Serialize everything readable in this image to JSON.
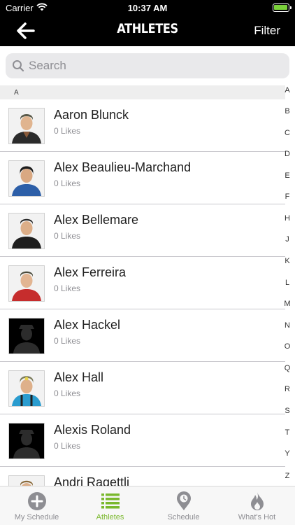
{
  "status_bar": {
    "carrier": "Carrier",
    "time": "10:37 AM"
  },
  "nav": {
    "title": "ATHLETES",
    "filter_label": "Filter"
  },
  "search": {
    "placeholder": "Search"
  },
  "section": {
    "header": "A"
  },
  "athletes": [
    {
      "name": "Aaron Blunck",
      "likes": "0 Likes",
      "avatar": "photo-dark-jacket-icon"
    },
    {
      "name": "Alex Beaulieu-Marchand",
      "likes": "0 Likes",
      "avatar": "photo-blue-jacket-icon"
    },
    {
      "name": "Alex Bellemare",
      "likes": "0 Likes",
      "avatar": "photo-black-jacket-icon"
    },
    {
      "name": "Alex Ferreira",
      "likes": "0 Likes",
      "avatar": "photo-red-jacket-icon"
    },
    {
      "name": "Alex Hackel",
      "likes": "0 Likes",
      "avatar": "silhouette-placeholder-icon"
    },
    {
      "name": "Alex Hall",
      "likes": "0 Likes",
      "avatar": "photo-teal-jacket-icon"
    },
    {
      "name": "Alexis Roland",
      "likes": "0 Likes",
      "avatar": "silhouette-placeholder-icon"
    },
    {
      "name": "Andri Ragettli",
      "likes": "",
      "avatar": "photo-partial-icon"
    }
  ],
  "index_letters": [
    "A",
    "B",
    "C",
    "D",
    "E",
    "F",
    "H",
    "J",
    "K",
    "L",
    "M",
    "N",
    "O",
    "Q",
    "R",
    "S",
    "T",
    "Y",
    "Z"
  ],
  "tabs": [
    {
      "label": "My Schedule",
      "icon": "plus-circle-icon",
      "active": false
    },
    {
      "label": "Athletes",
      "icon": "list-icon",
      "active": true
    },
    {
      "label": "Schedule",
      "icon": "map-pin-icon",
      "active": false
    },
    {
      "label": "What's Hot",
      "icon": "flame-icon",
      "active": false
    }
  ],
  "colors": {
    "accent": "#7ab82d",
    "bar": "#000000"
  }
}
